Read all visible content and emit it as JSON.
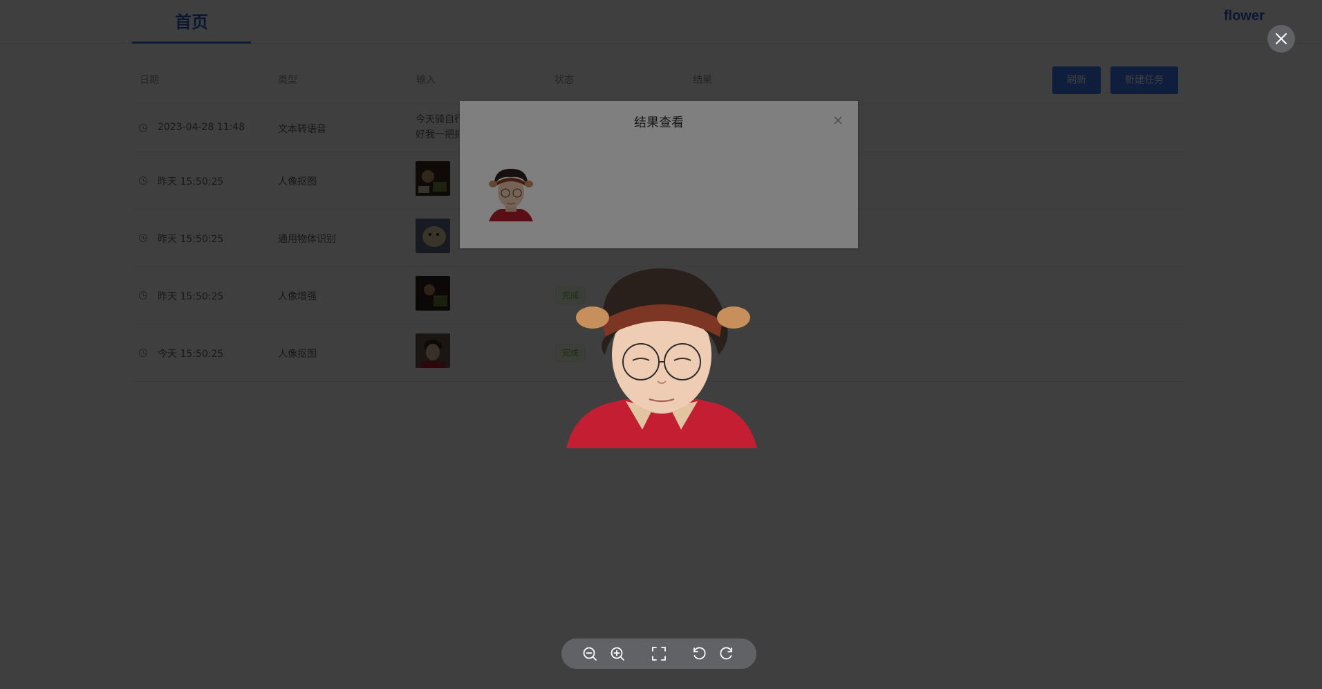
{
  "header": {
    "tab_home": "首页",
    "brand": "flower"
  },
  "table": {
    "columns": [
      "日期",
      "类型",
      "输入",
      "状态",
      "结果"
    ],
    "refresh_label": "刷新",
    "new_task_label": "新建任务",
    "rows": [
      {
        "date": "2023-04-28 11:48",
        "type": "文本转语音",
        "input_line1": "今天骑自行",
        "input_line2": "好我一把抓",
        "status": ""
      },
      {
        "date": "昨天 15:50:25",
        "type": "人像抠图",
        "input_line1": "",
        "input_line2": "",
        "status": ""
      },
      {
        "date": "昨天 15:50:25",
        "type": "通用物体识别",
        "input_line1": "",
        "input_line2": "",
        "status": ""
      },
      {
        "date": "昨天 15:50:25",
        "type": "人像增强",
        "input_line1": "",
        "input_line2": "",
        "status": "完成"
      },
      {
        "date": "今天 15:50:25",
        "type": "人像抠图",
        "input_line1": "",
        "input_line2": "",
        "status": "完成"
      }
    ]
  },
  "dialog": {
    "title": "结果查看"
  },
  "viewer": {
    "tools": [
      "zoom-out-icon",
      "zoom-in-icon",
      "fullscreen-icon",
      "rotate-left-icon",
      "rotate-right-icon"
    ]
  },
  "colors": {
    "accent": "#3c78f0",
    "success": "#67c23a",
    "mask": "rgba(0,0,0,0.5)"
  }
}
